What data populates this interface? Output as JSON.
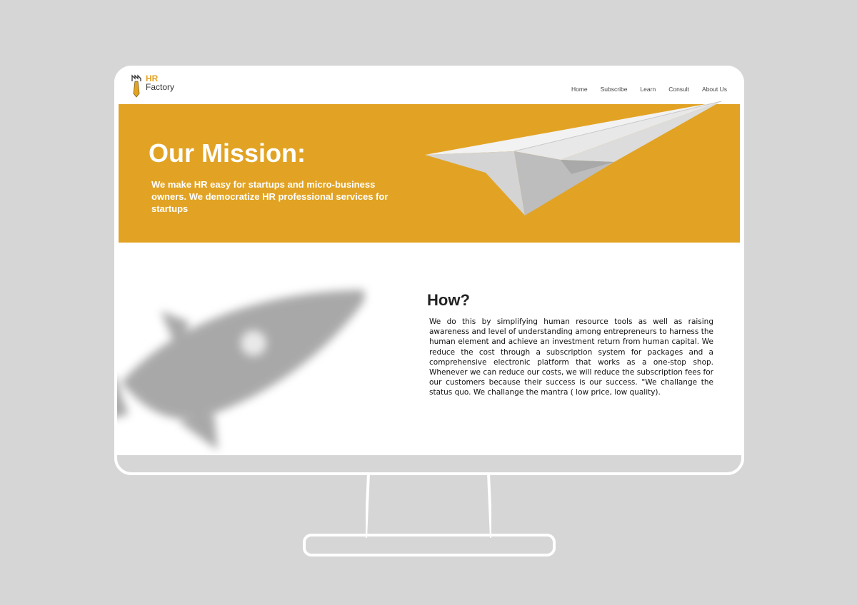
{
  "logo": {
    "line1": "HR",
    "line2": "Factory"
  },
  "nav": {
    "items": [
      "Home",
      "Subscribe",
      "Learn",
      "Consult",
      "About Us"
    ]
  },
  "hero": {
    "title": "Our Mission:",
    "text": "We make HR easy for startups and micro-business owners.  We democratize HR professional services for startups"
  },
  "how": {
    "title": "How?",
    "text": "We do this by simplifying human resource tools as well as raising awareness and level of understanding among entrepreneurs to harness the human element and achieve an investment return from human capital. We reduce the cost through a subscription system for packages and a comprehensive electronic platform that works as a one-stop shop. Whenever we can reduce our costs, we will reduce the subscription fees for our customers because their success is our success. \"We challange the status quo. We challange the mantra ( low price, low quality)."
  },
  "colors": {
    "brand": "#e2a324",
    "background": "#d6d6d6",
    "text": "#222222"
  },
  "icons": {
    "logo": "factory-tie-logo-icon",
    "hero_image": "paper-plane-icon",
    "how_image": "rocket-icon"
  }
}
